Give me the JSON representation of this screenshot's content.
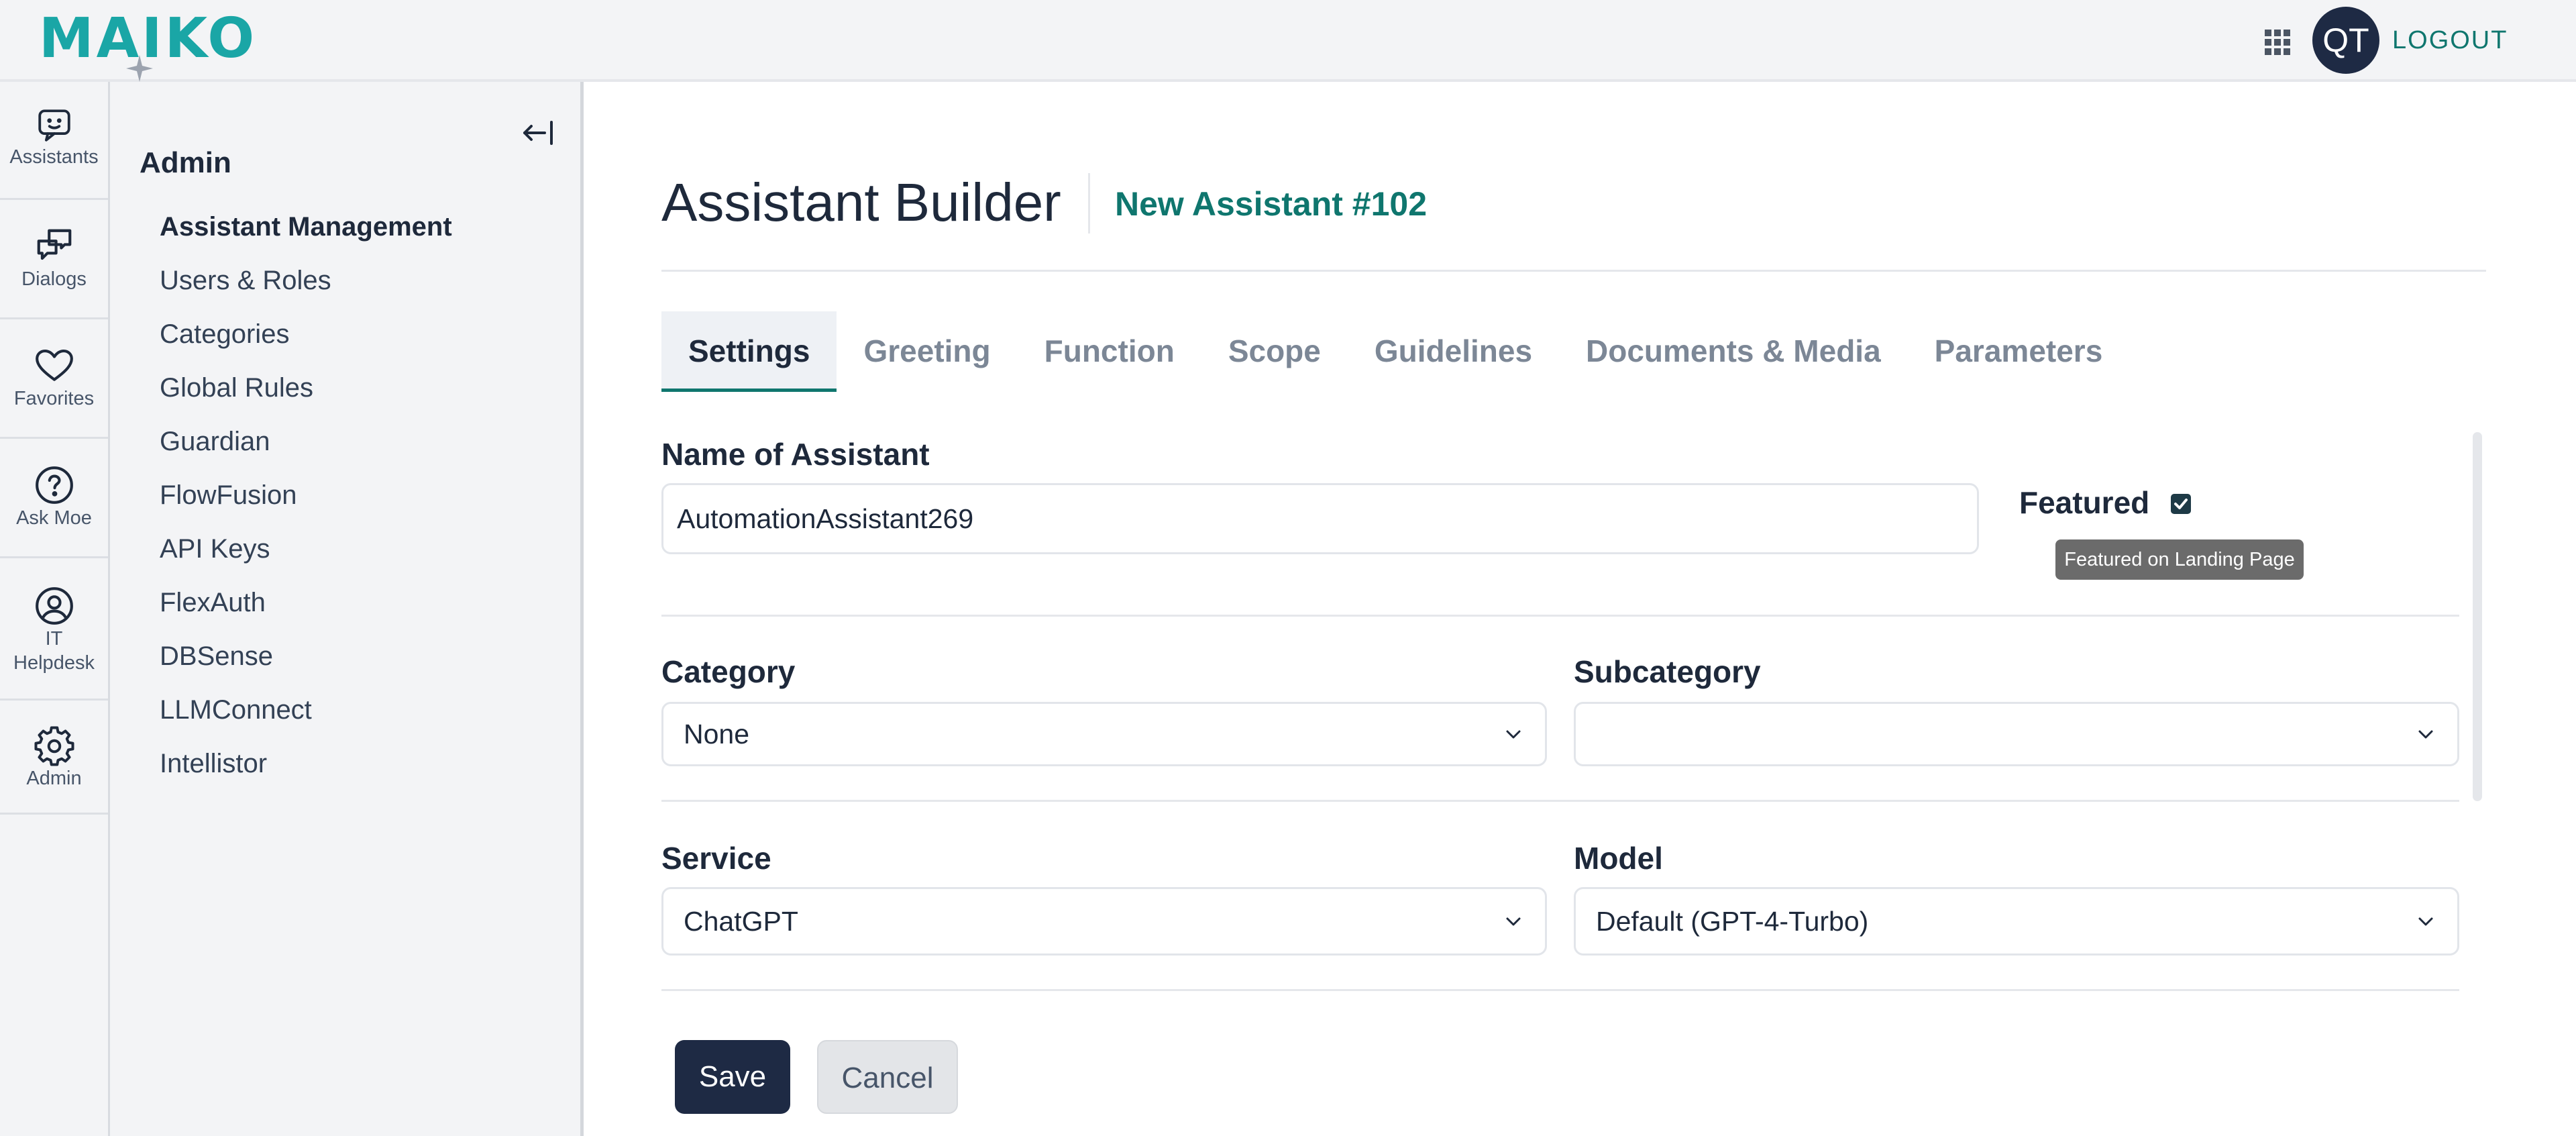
{
  "brand": {
    "name": "MAIKO",
    "primary": "#1aa6a6",
    "dark": "#1e2a44",
    "accent_text": "#0f766e"
  },
  "header": {
    "avatar_initials": "QT",
    "logout_label": "LOGOUT"
  },
  "rail": [
    {
      "id": "assistants",
      "label": "Assistants",
      "icon": "chat-smile-icon"
    },
    {
      "id": "dialogs",
      "label": "Dialogs",
      "icon": "dialogs-icon"
    },
    {
      "id": "favorites",
      "label": "Favorites",
      "icon": "heart-icon"
    },
    {
      "id": "ask-moe",
      "label": "Ask Moe",
      "icon": "question-icon"
    },
    {
      "id": "it-helpdesk",
      "label_line1": "IT",
      "label_line2": "Helpdesk",
      "icon": "user-circle-icon"
    },
    {
      "id": "admin",
      "label": "Admin",
      "icon": "gear-icon"
    }
  ],
  "nav": {
    "title": "Admin",
    "items": [
      "Assistant Management",
      "Users & Roles",
      "Categories",
      "Global Rules",
      "Guardian",
      "FlowFusion",
      "API Keys",
      "FlexAuth",
      "DBSense",
      "LLMConnect",
      "Intellistor"
    ],
    "active_index": 0
  },
  "page": {
    "title": "Assistant Builder",
    "subtitle": "New Assistant #102"
  },
  "tabs": [
    "Settings",
    "Greeting",
    "Function",
    "Scope",
    "Guidelines",
    "Documents & Media",
    "Parameters"
  ],
  "active_tab": 0,
  "form": {
    "name_label": "Name of Assistant",
    "name_value": "AutomationAssistant269",
    "featured_label": "Featured",
    "featured_checked": true,
    "featured_tooltip": "Featured on Landing Page",
    "category_label": "Category",
    "category_value": "None",
    "subcategory_label": "Subcategory",
    "subcategory_value": "",
    "service_label": "Service",
    "service_value": "ChatGPT",
    "model_label": "Model",
    "model_value": "Default (GPT-4-Turbo)"
  },
  "actions": {
    "save_label": "Save",
    "cancel_label": "Cancel"
  }
}
